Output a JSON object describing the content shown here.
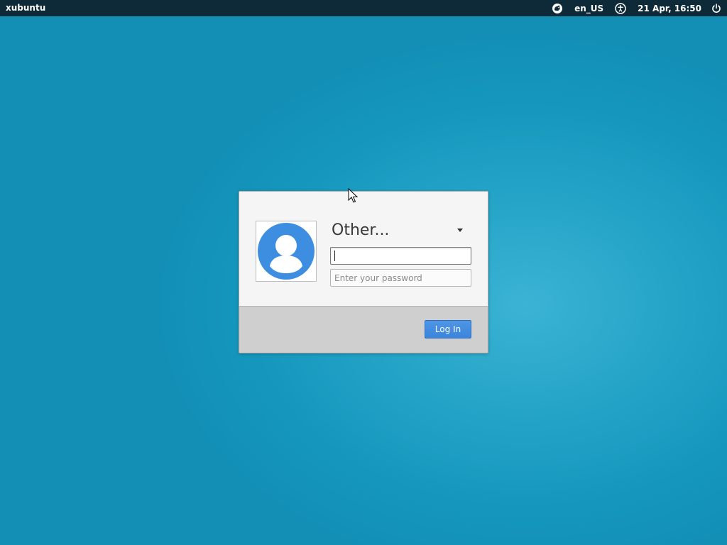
{
  "topbar": {
    "hostname": "xubuntu",
    "session_icon": "session-icon",
    "keyboard_layout": "en_US",
    "accessibility_icon": "accessibility-icon",
    "datetime": "21 Apr, 16:50",
    "power_icon": "power-icon"
  },
  "login": {
    "avatar_icon": "user-avatar-icon",
    "user_selected": "Other...",
    "username_value": "",
    "password_placeholder": "Enter your password",
    "login_button_label": "Log In"
  },
  "colors": {
    "background": "#1b9bc1",
    "topbar": "#0e2a38",
    "avatar": "#3d8ee0",
    "login_button": "#3c85da"
  }
}
